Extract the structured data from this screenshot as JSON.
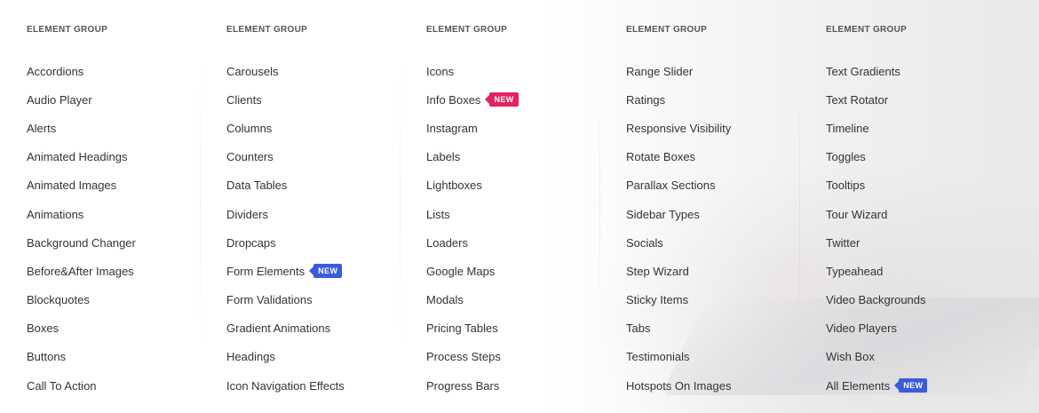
{
  "columns": [
    {
      "heading": "ELEMENT GROUP",
      "items": [
        {
          "label": "Accordions"
        },
        {
          "label": "Audio Player"
        },
        {
          "label": "Alerts"
        },
        {
          "label": "Animated Headings"
        },
        {
          "label": "Animated Images"
        },
        {
          "label": "Animations"
        },
        {
          "label": "Background Changer"
        },
        {
          "label": "Before&After Images"
        },
        {
          "label": "Blockquotes"
        },
        {
          "label": "Boxes"
        },
        {
          "label": "Buttons"
        },
        {
          "label": "Call To Action"
        }
      ]
    },
    {
      "heading": "ELEMENT GROUP",
      "items": [
        {
          "label": "Carousels"
        },
        {
          "label": "Clients"
        },
        {
          "label": "Columns"
        },
        {
          "label": "Counters"
        },
        {
          "label": "Data Tables"
        },
        {
          "label": "Dividers"
        },
        {
          "label": "Dropcaps"
        },
        {
          "label": "Form Elements",
          "badge": "NEW",
          "badge_color": "#3b5bdb"
        },
        {
          "label": "Form Validations"
        },
        {
          "label": "Gradient Animations"
        },
        {
          "label": "Headings"
        },
        {
          "label": "Icon Navigation Effects"
        }
      ]
    },
    {
      "heading": "ELEMENT GROUP",
      "items": [
        {
          "label": "Icons"
        },
        {
          "label": "Info Boxes",
          "badge": "NEW",
          "badge_color": "#e0245e"
        },
        {
          "label": "Instagram"
        },
        {
          "label": "Labels"
        },
        {
          "label": "Lightboxes"
        },
        {
          "label": "Lists"
        },
        {
          "label": "Loaders"
        },
        {
          "label": "Google Maps"
        },
        {
          "label": "Modals"
        },
        {
          "label": "Pricing Tables"
        },
        {
          "label": "Process Steps"
        },
        {
          "label": "Progress Bars"
        }
      ]
    },
    {
      "heading": "ELEMENT GROUP",
      "items": [
        {
          "label": "Range Slider"
        },
        {
          "label": "Ratings"
        },
        {
          "label": "Responsive Visibility"
        },
        {
          "label": "Rotate Boxes"
        },
        {
          "label": "Parallax Sections"
        },
        {
          "label": "Sidebar Types"
        },
        {
          "label": "Socials"
        },
        {
          "label": "Step Wizard"
        },
        {
          "label": "Sticky Items"
        },
        {
          "label": "Tabs"
        },
        {
          "label": "Testimonials"
        },
        {
          "label": "Hotspots On Images"
        }
      ]
    },
    {
      "heading": "ELEMENT GROUP",
      "items": [
        {
          "label": "Text Gradients"
        },
        {
          "label": "Text Rotator"
        },
        {
          "label": "Timeline"
        },
        {
          "label": "Toggles"
        },
        {
          "label": "Tooltips"
        },
        {
          "label": "Tour Wizard"
        },
        {
          "label": "Twitter"
        },
        {
          "label": "Typeahead"
        },
        {
          "label": "Video Backgrounds"
        },
        {
          "label": "Video Players"
        },
        {
          "label": "Wish Box"
        },
        {
          "label": "All Elements",
          "badge": "NEW",
          "badge_color": "#3b5bdb"
        }
      ]
    }
  ]
}
